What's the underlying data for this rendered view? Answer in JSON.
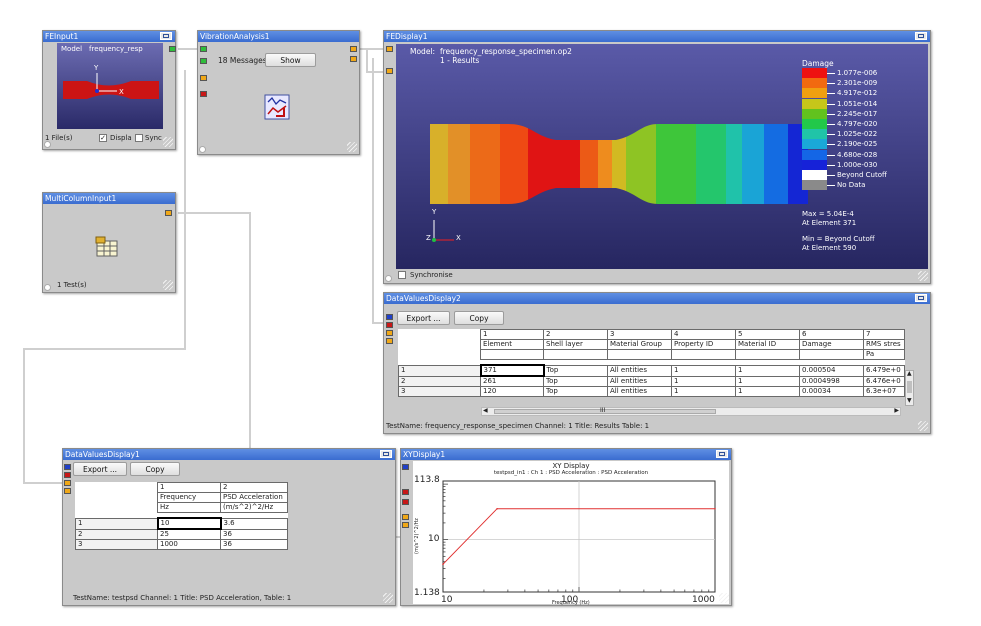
{
  "fe_input": {
    "title": "FEInput1",
    "model_label": "Model",
    "model_value": "frequency_resp",
    "files": "1 File(s)",
    "display_cb": "Displa",
    "sync_cb": "Sync"
  },
  "vibration": {
    "title": "VibrationAnalysis1",
    "messages": "18 Messages",
    "show_label": "Show"
  },
  "multi_input": {
    "title": "MultiColumnInput1",
    "tests": "1 Test(s)"
  },
  "fe_display": {
    "title": "FEDisplay1",
    "model_label": "Model:",
    "model_value": "frequency_response_specimen.op2",
    "results": "1 - Results",
    "legend_title": "Damage",
    "legend": [
      {
        "color": "#ee1111",
        "label": "1.077e-006"
      },
      {
        "color": "#f26a10",
        "label": "2.301e-009"
      },
      {
        "color": "#f0a010",
        "label": "4.917e-012"
      },
      {
        "color": "#c6c61a",
        "label": "1.051e-014"
      },
      {
        "color": "#62c21e",
        "label": "2.245e-017"
      },
      {
        "color": "#22c84a",
        "label": "4.797e-020"
      },
      {
        "color": "#20c4a8",
        "label": "1.025e-022"
      },
      {
        "color": "#1aa8d8",
        "label": "2.190e-025"
      },
      {
        "color": "#1466e6",
        "label": "4.680e-028"
      },
      {
        "color": "#1622d8",
        "label": "1.000e-030"
      },
      {
        "color": "#ffffff",
        "label": "Beyond Cutoff"
      },
      {
        "color": "#8a8a8a",
        "label": "No Data"
      }
    ],
    "max_text": "Max = 5.04E-4",
    "max_elem": "At Element 371",
    "min_text": "Min = Beyond Cutoff",
    "min_elem": "At Element 590",
    "sync_label": "Synchronise",
    "axis_y": "Y",
    "axis_z": "Z",
    "axis_x": "X"
  },
  "dv2": {
    "title": "DataValuesDisplay2",
    "export_label": "Export ...",
    "copy_label": "Copy",
    "col_nums": [
      "1",
      "2",
      "3",
      "4",
      "5",
      "6",
      "7"
    ],
    "col_names": [
      "Element",
      "Shell layer",
      "Material Group",
      "Property ID",
      "Material ID",
      "Damage",
      "RMS stres"
    ],
    "col_units": [
      "",
      "",
      "",
      "",
      "",
      "",
      "Pa"
    ],
    "rows": [
      {
        "num": "1",
        "cells": [
          "371",
          "Top",
          "All entities",
          "1",
          "1",
          "0.000504",
          "6.479e+0"
        ]
      },
      {
        "num": "2",
        "cells": [
          "261",
          "Top",
          "All entities",
          "1",
          "1",
          "0.0004998",
          "6.476e+0"
        ]
      },
      {
        "num": "3",
        "cells": [
          "120",
          "Top",
          "All entities",
          "1",
          "1",
          "0.00034",
          "6.3e+07"
        ]
      }
    ],
    "scroll_mid": "III",
    "status": "TestName: frequency_response_specimen  Channel: 1  Title: Results  Table: 1"
  },
  "dv1": {
    "title": "DataValuesDisplay1",
    "export_label": "Export ...",
    "copy_label": "Copy",
    "col_nums": [
      "1",
      "2"
    ],
    "col_names": [
      "Frequency",
      "PSD Acceleration"
    ],
    "col_units": [
      "Hz",
      "(m/s^2)^2/Hz"
    ],
    "rows": [
      {
        "num": "1",
        "cells": [
          "10",
          "3.6"
        ]
      },
      {
        "num": "2",
        "cells": [
          "25",
          "36"
        ]
      },
      {
        "num": "3",
        "cells": [
          "1000",
          "36"
        ]
      }
    ],
    "status": "TestName: testpsd  Channel: 1  Title: PSD Acceleration,  Table: 1"
  },
  "xy": {
    "title": "XYDisplay1",
    "chart_title": "XY Display",
    "chart_subtitle": "testpsd_in1 : Ch 1 : PSD Acceleration : PSD Acceleration",
    "y_ticks": [
      "113.8",
      "10",
      "1.138"
    ],
    "x_ticks": [
      "10",
      "100",
      "1000"
    ],
    "xlabel": "Frequency (Hz)",
    "ylabel": "(m/s^2)^2/Hz"
  },
  "chart_data": {
    "type": "line",
    "title": "XY Display",
    "subtitle": "testpsd_in1 : Ch 1 : PSD Acceleration : PSD Acceleration",
    "xlabel": "Frequency (Hz)",
    "ylabel": "(m/s^2)^2/Hz",
    "xscale": "log",
    "yscale": "log",
    "xlim": [
      10,
      1000
    ],
    "ylim": [
      1.138,
      113.8
    ],
    "series": [
      {
        "name": "PSD Acceleration",
        "x": [
          10,
          25,
          1000
        ],
        "y": [
          3.6,
          36,
          36
        ],
        "color": "#e03030"
      }
    ]
  }
}
